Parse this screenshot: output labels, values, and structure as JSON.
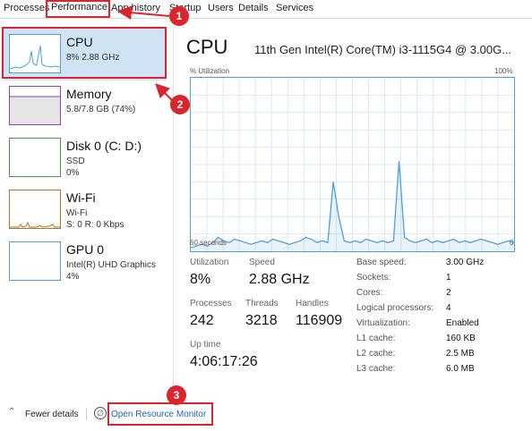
{
  "tabs": [
    "Processes",
    "Performance",
    "App history",
    "Startup",
    "Users",
    "Details",
    "Services"
  ],
  "sidebar": {
    "items": [
      {
        "title": "CPU",
        "sub1": "8%  2.88 GHz",
        "sub2": ""
      },
      {
        "title": "Memory",
        "sub1": "5.8/7.8 GB (74%)",
        "sub2": ""
      },
      {
        "title": "Disk 0 (C: D:)",
        "sub1": "SSD",
        "sub2": "0%"
      },
      {
        "title": "Wi-Fi",
        "sub1": "Wi-Fi",
        "sub2": "S: 0  R: 0 Kbps"
      },
      {
        "title": "GPU 0",
        "sub1": "Intel(R) UHD Graphics",
        "sub2": "4%"
      }
    ]
  },
  "main": {
    "title": "CPU",
    "model": "11th Gen Intel(R) Core(TM) i3-1115G4 @ 3.00G...",
    "graph": {
      "ylabel": "% Utilization",
      "ymax_label": "100%",
      "xlabel": "60 seconds",
      "xmin_label": "0",
      "utilization_series": [
        2,
        3,
        4,
        3,
        5,
        8,
        6,
        5,
        7,
        6,
        5,
        4,
        5,
        6,
        5,
        7,
        6,
        5,
        4,
        5,
        6,
        8,
        7,
        5,
        6,
        5,
        40,
        20,
        6,
        5,
        6,
        5,
        7,
        6,
        5,
        6,
        5,
        6,
        52,
        8,
        6,
        5,
        6,
        7,
        5,
        6,
        5,
        6,
        7,
        5,
        6,
        5,
        6,
        7,
        6,
        5,
        4,
        5,
        6,
        5
      ]
    },
    "stats": {
      "utilization_label": "Utilization",
      "utilization": "8%",
      "speed_label": "Speed",
      "speed": "2.88 GHz",
      "processes_label": "Processes",
      "processes": "242",
      "threads_label": "Threads",
      "threads": "3218",
      "handles_label": "Handles",
      "handles": "116909",
      "uptime_label": "Up time",
      "uptime": "4:06:17:26"
    },
    "specs": [
      {
        "label": "Base speed:",
        "value": "3.00 GHz"
      },
      {
        "label": "Sockets:",
        "value": "1"
      },
      {
        "label": "Cores:",
        "value": "2"
      },
      {
        "label": "Logical processors:",
        "value": "4"
      },
      {
        "label": "Virtualization:",
        "value": "Enabled"
      },
      {
        "label": "L1 cache:",
        "value": "160 KB"
      },
      {
        "label": "L2 cache:",
        "value": "2.5 MB"
      },
      {
        "label": "L3 cache:",
        "value": "6.0 MB"
      }
    ]
  },
  "footer": {
    "fewer_details": "Fewer details",
    "resource_monitor": "Open Resource Monitor",
    "icons": [
      "chevron-up-icon",
      "resource-monitor-icon"
    ]
  },
  "annotations": [
    "1",
    "2",
    "3"
  ],
  "colors": {
    "accent": "#4fa0d8",
    "highlight": "#d9252b",
    "selected_bg": "#cfe3f4",
    "memory": "#8b44ad",
    "disk": "#3d9a3d",
    "wifi": "#a9762a",
    "link": "#1c63b7"
  }
}
